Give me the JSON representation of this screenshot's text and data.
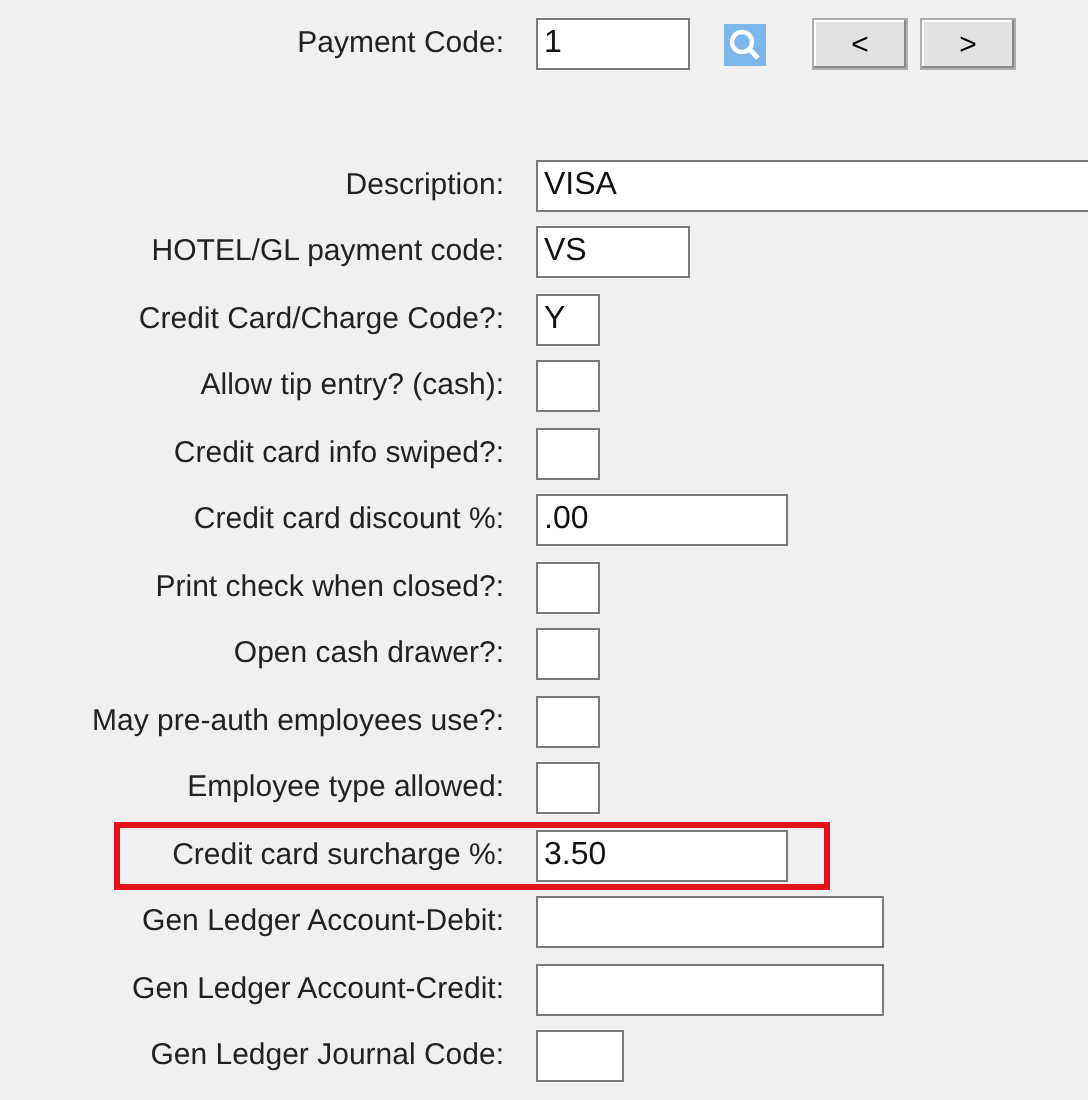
{
  "payment_code": {
    "label": "Payment Code:",
    "value": "1",
    "buttons": [
      "<",
      ">"
    ]
  },
  "fields": [
    {
      "label": "Description:",
      "value": "VISA",
      "kind": "full",
      "highlighted": false
    },
    {
      "label": "HOTEL/GL payment code:",
      "value": "VS",
      "kind": "short",
      "highlighted": false
    },
    {
      "label": "Credit Card/Charge Code?:",
      "value": "Y",
      "kind": "tiny",
      "highlighted": false
    },
    {
      "label": "Allow tip entry? (cash):",
      "kind": "tiny",
      "highlighted": false
    },
    {
      "label": "Credit card info swiped?:",
      "kind": "tiny",
      "highlighted": false
    },
    {
      "label": "Credit card discount %:",
      "value": ".00",
      "kind": "medium",
      "highlighted": false
    },
    {
      "label": "Print check when closed?:",
      "kind": "tiny",
      "highlighted": false
    },
    {
      "label": "Open cash drawer?:",
      "kind": "tiny",
      "highlighted": false
    },
    {
      "label": "May pre-auth employees use?:",
      "kind": "tiny",
      "highlighted": false
    },
    {
      "label": "Employee type allowed:",
      "kind": "tiny",
      "highlighted": false
    },
    {
      "label": "Credit card surcharge %:",
      "value": "3.50",
      "kind": "medium",
      "highlighted": true
    },
    {
      "label": "Gen Ledger Account-Debit:",
      "kind": "long",
      "highlighted": false
    },
    {
      "label": "Gen Ledger Account-Credit:",
      "kind": "long",
      "highlighted": false
    },
    {
      "label": "Gen Ledger Journal Code:",
      "kind": "small",
      "highlighted": false
    }
  ]
}
